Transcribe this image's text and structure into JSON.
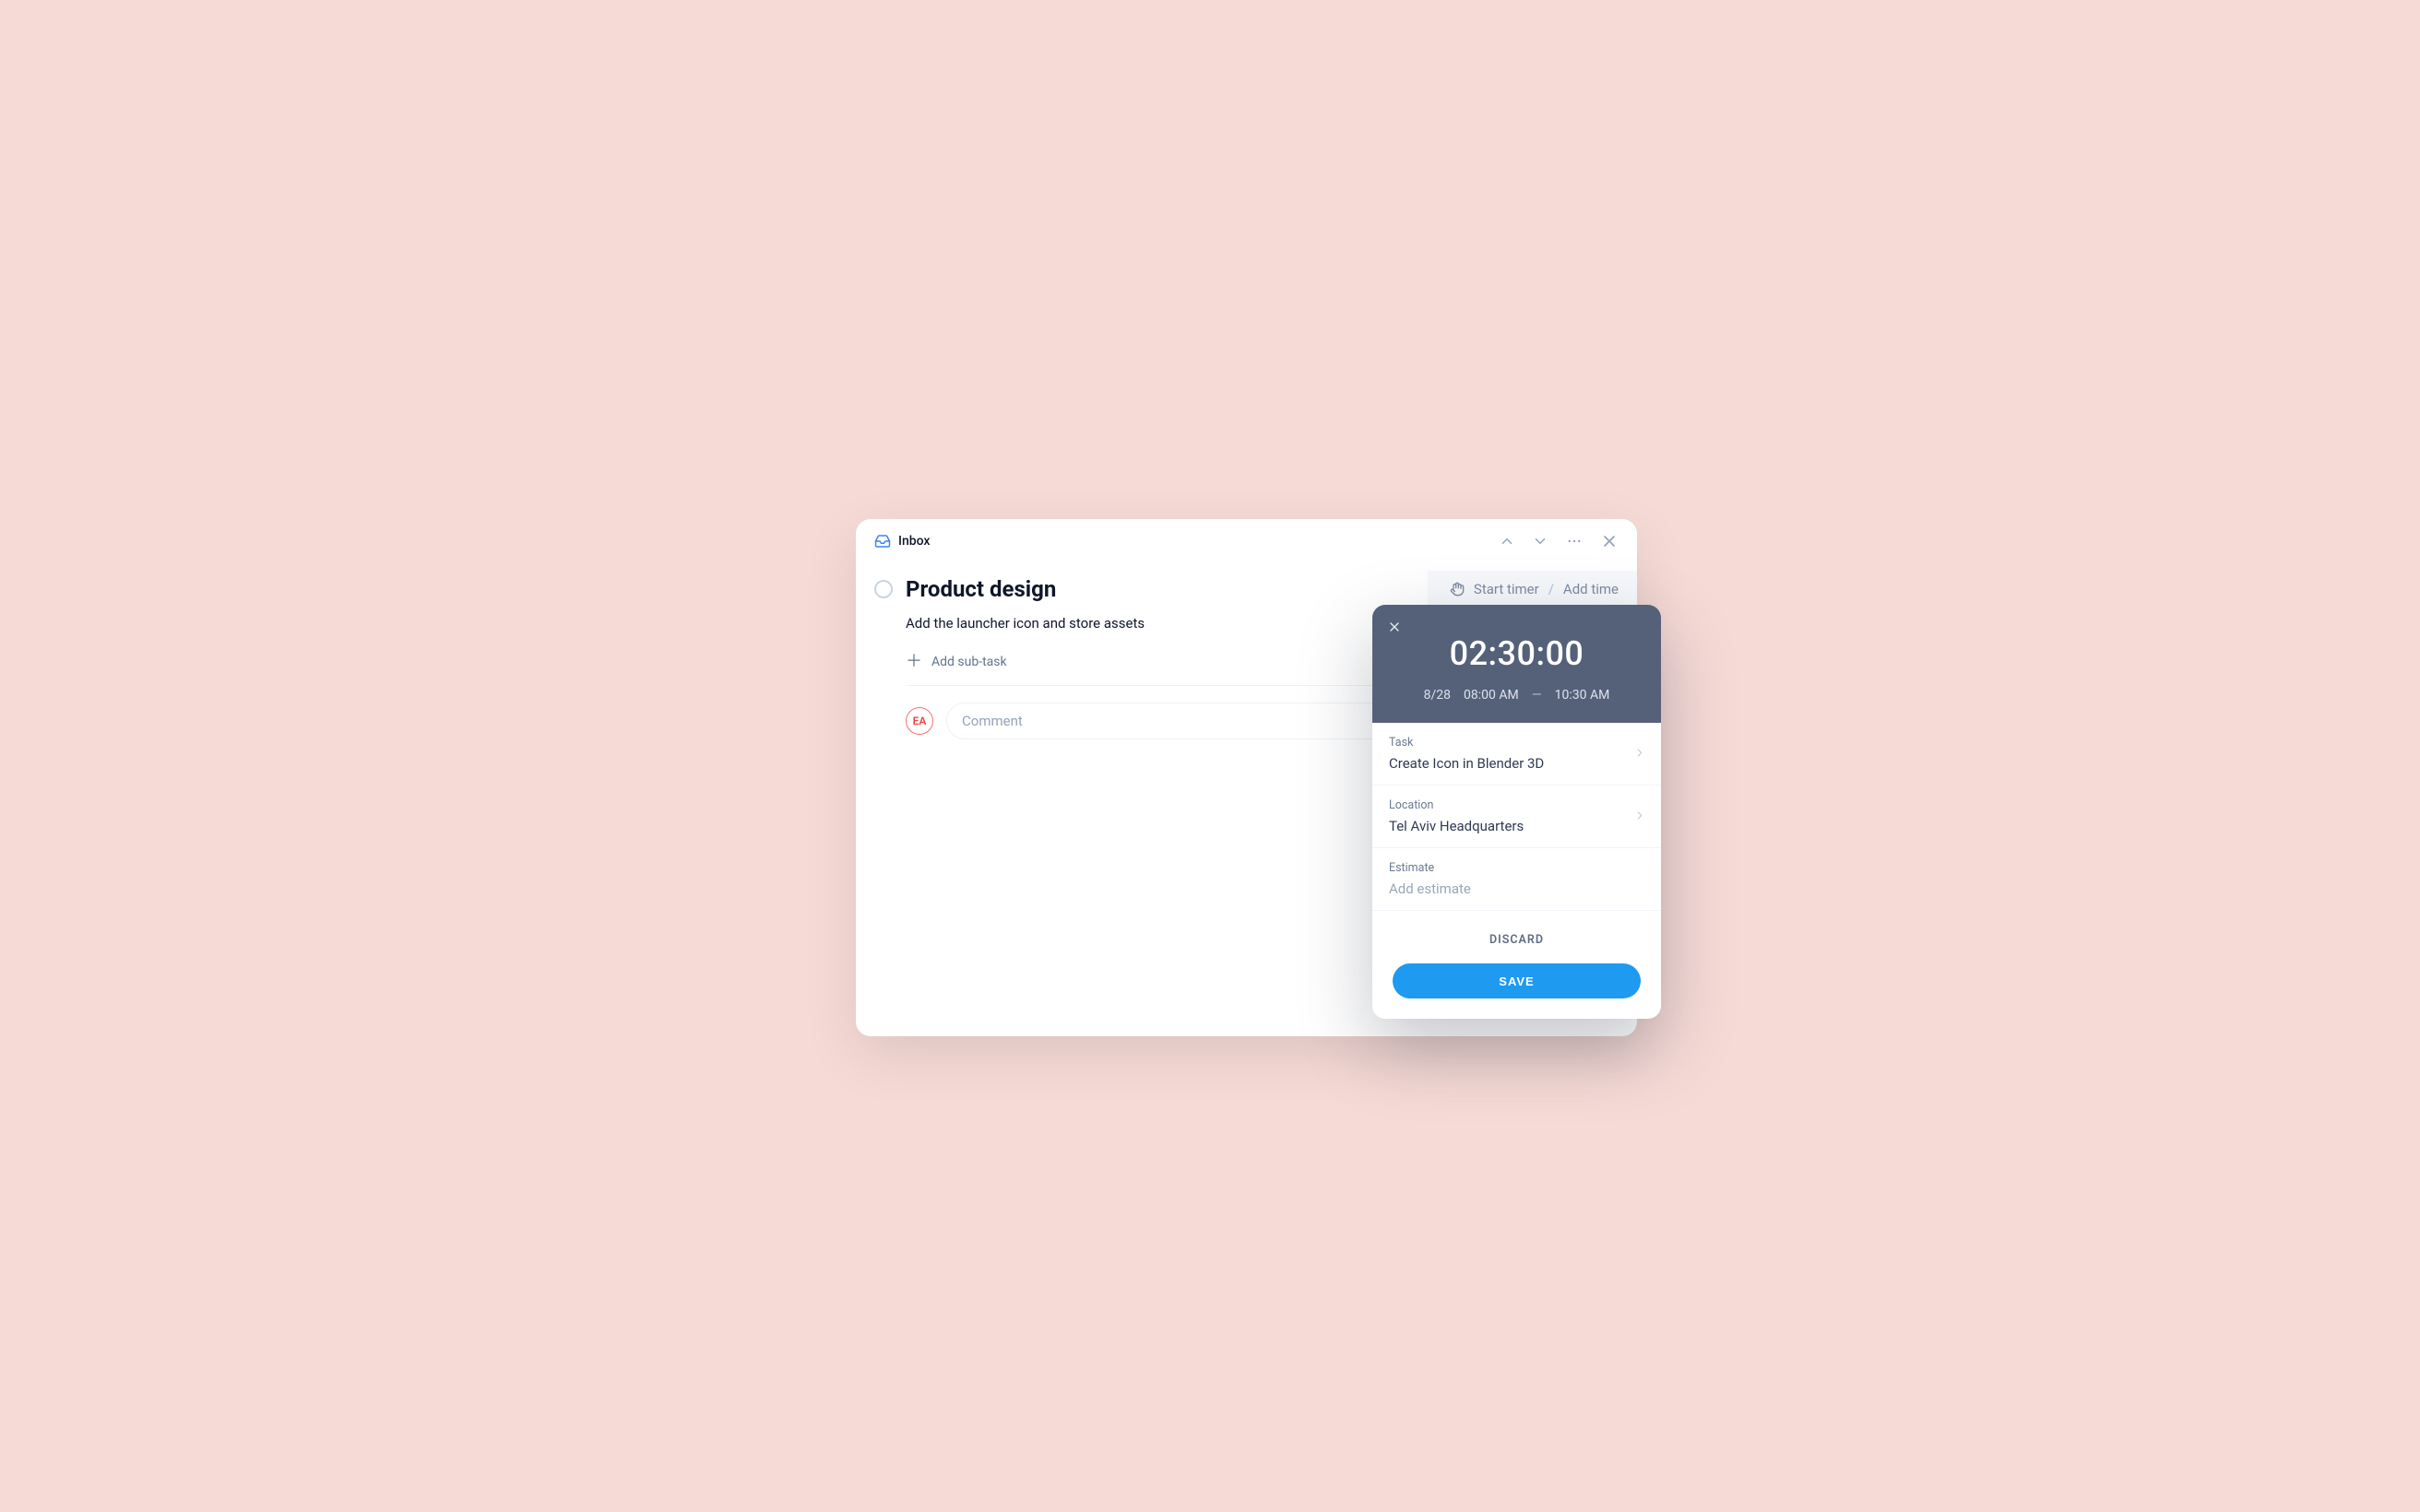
{
  "header": {
    "inbox_label": "Inbox"
  },
  "task": {
    "title": "Product design",
    "description": "Add the launcher icon and store assets",
    "add_subtask": "Add sub-task",
    "avatar_initials": "EA",
    "comment_placeholder": "Comment"
  },
  "timer_bar": {
    "start": "Start timer",
    "separator": "/",
    "add": "Add time"
  },
  "popover": {
    "duration": "02:30:00",
    "date": "8/28",
    "start_time": "08:00 AM",
    "end_time": "10:30 AM",
    "task_label": "Task",
    "task_value": "Create Icon in Blender 3D",
    "location_label": "Location",
    "location_value": "Tel Aviv Headquarters",
    "estimate_label": "Estimate",
    "estimate_placeholder": "Add estimate",
    "discard": "DISCARD",
    "save": "SAVE"
  }
}
